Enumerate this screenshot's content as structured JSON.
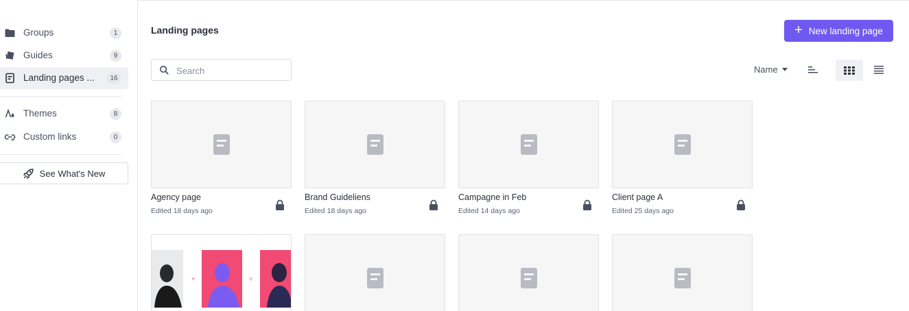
{
  "sidebar": {
    "items": [
      {
        "label": "Groups",
        "count": "1",
        "icon": "folder-icon"
      },
      {
        "label": "Guides",
        "count": "9",
        "icon": "guides-icon"
      },
      {
        "label": "Landing pages ...",
        "count": "16",
        "icon": "landing-page-icon",
        "active": true
      },
      {
        "label": "Themes",
        "count": "8",
        "icon": "themes-icon"
      },
      {
        "label": "Custom links",
        "count": "0",
        "icon": "custom-link-icon"
      }
    ],
    "whats_new_label": "See What's New"
  },
  "main": {
    "title": "Landing pages",
    "new_button_label": "New landing page",
    "search_placeholder": "Search",
    "sort_label": "Name",
    "accent_color": "#7059f0",
    "cards": [
      {
        "name": "Agency page",
        "edited": "Edited 18 days ago",
        "locked": true
      },
      {
        "name": "Brand Guideliens",
        "edited": "Edited 18 days ago",
        "locked": true
      },
      {
        "name": "Campagne in Feb",
        "edited": "Edited 14 days ago",
        "locked": true
      },
      {
        "name": "Client page A",
        "edited": "Edited 25 days ago",
        "locked": true
      },
      {
        "name": "",
        "edited": "",
        "thumbnail": "image-collage"
      },
      {
        "name": "",
        "edited": ""
      },
      {
        "name": "",
        "edited": ""
      },
      {
        "name": "",
        "edited": ""
      }
    ]
  }
}
